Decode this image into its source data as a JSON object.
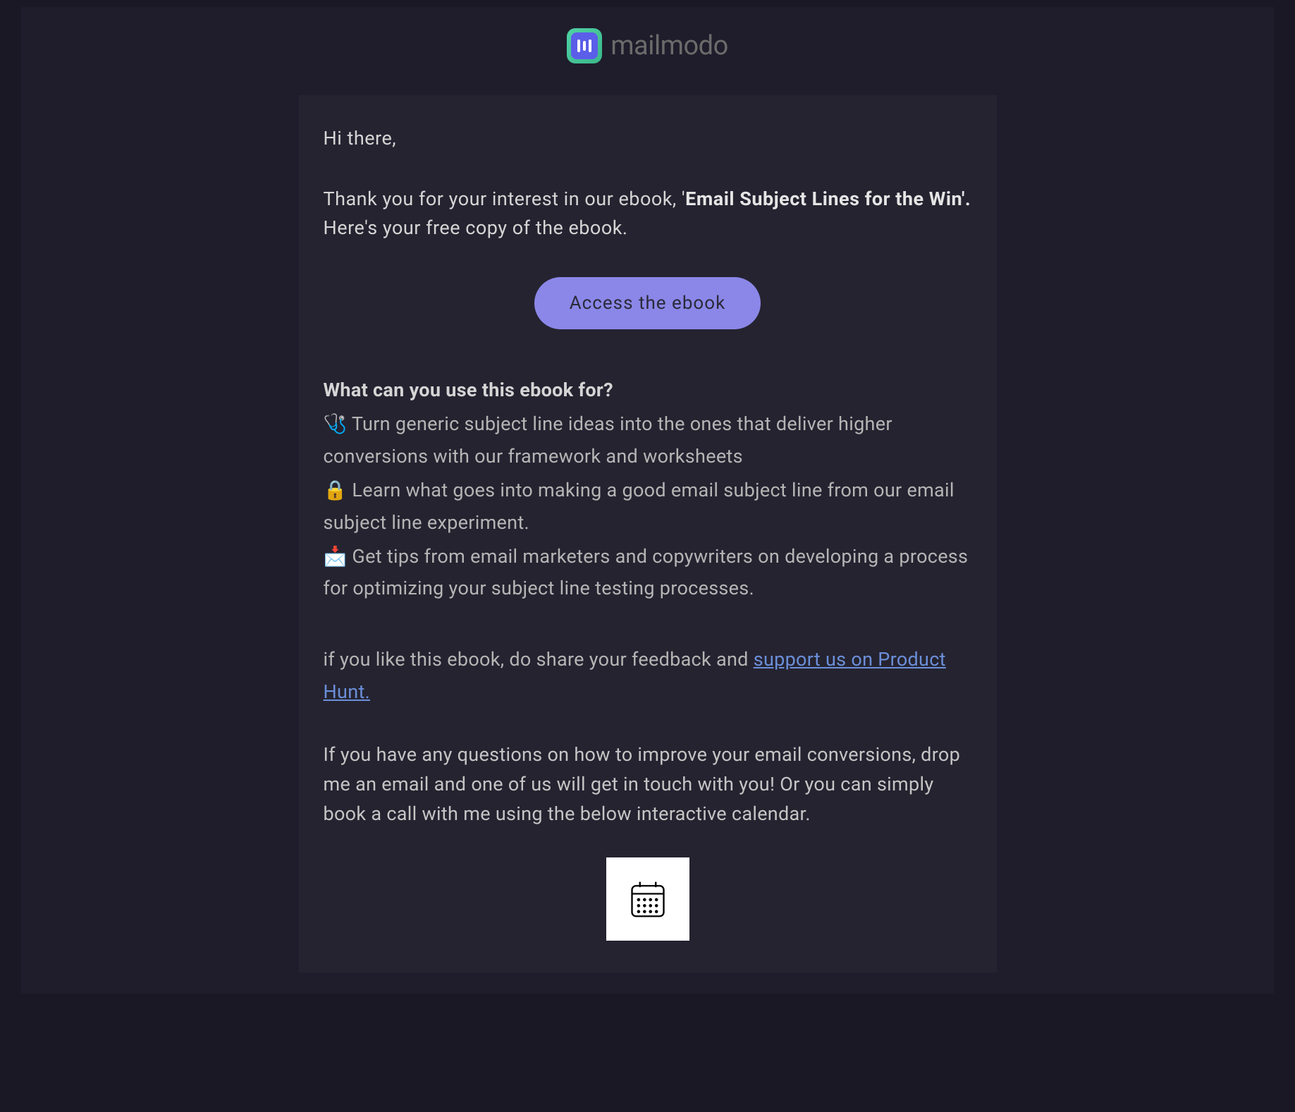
{
  "brand": {
    "name": "mailmodo"
  },
  "email": {
    "greeting": "Hi there,",
    "intro_prefix": "Thank you for your interest in our ebook, '",
    "ebook_title": "Email Subject Lines for the Win'.",
    "intro_suffix": " Here's your free copy of the ebook.",
    "cta_label": "Access the ebook",
    "section_heading": "What can you use this ebook for?",
    "bullets": [
      {
        "emoji": "🩺",
        "text": " Turn generic subject line ideas into the ones that deliver higher conversions with our framework and worksheets"
      },
      {
        "emoji": "🔒",
        "text": " Learn what goes into making a good email subject line from our email subject line experiment."
      },
      {
        "emoji": "📩",
        "text": " Get tips from email marketers and copywriters on developing a process for optimizing your subject line testing processes."
      }
    ],
    "feedback_prefix": "if you like this ebook, do share your feedback and ",
    "feedback_link": "support us on Product Hunt. ",
    "closing": "If you have any questions on how to improve your email conversions, drop me an email and one of us will get in touch with you! Or you can simply book a call with me using the below interactive calendar."
  }
}
